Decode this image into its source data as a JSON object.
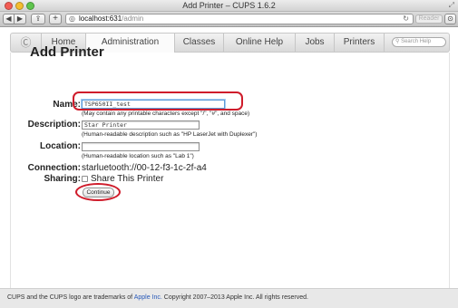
{
  "window": {
    "title": "Add Printer – CUPS 1.6.2"
  },
  "toolbar": {
    "url_host": "localhost:631",
    "url_path": "/admin",
    "reader_label": "Reader",
    "plus_label": "+"
  },
  "nav": {
    "items": [
      "Home",
      "Administration",
      "Classes",
      "Online Help",
      "Jobs",
      "Printers"
    ],
    "active": "Administration",
    "search_placeholder": "Search Help"
  },
  "form": {
    "heading": "Add Printer",
    "name_label": "Name:",
    "name_value": "TSP650II_test",
    "name_hint": "(May contain any printable characters except \"/\", \"#\", and space)",
    "description_label": "Description:",
    "description_value": "Star Printer",
    "description_hint": "(Human-readable description such as \"HP LaserJet with Duplexer\")",
    "location_label": "Location:",
    "location_value": "",
    "location_hint": "(Human-readable location such as \"Lab 1\")",
    "connection_label": "Connection:",
    "connection_value": "starluetooth://00-12-f3-1c-2f-a4",
    "sharing_label": "Sharing:",
    "sharing_option": "Share This Printer",
    "sharing_checked": false,
    "continue_label": "Continue"
  },
  "footer": {
    "prefix": "CUPS and the CUPS logo are trademarks of ",
    "link": "Apple Inc.",
    "suffix": " Copyright 2007–2013 Apple Inc. All rights reserved."
  },
  "colors": {
    "annotation": "#cf1c2b",
    "link": "#2859b8",
    "focus": "#5b9bd8"
  }
}
